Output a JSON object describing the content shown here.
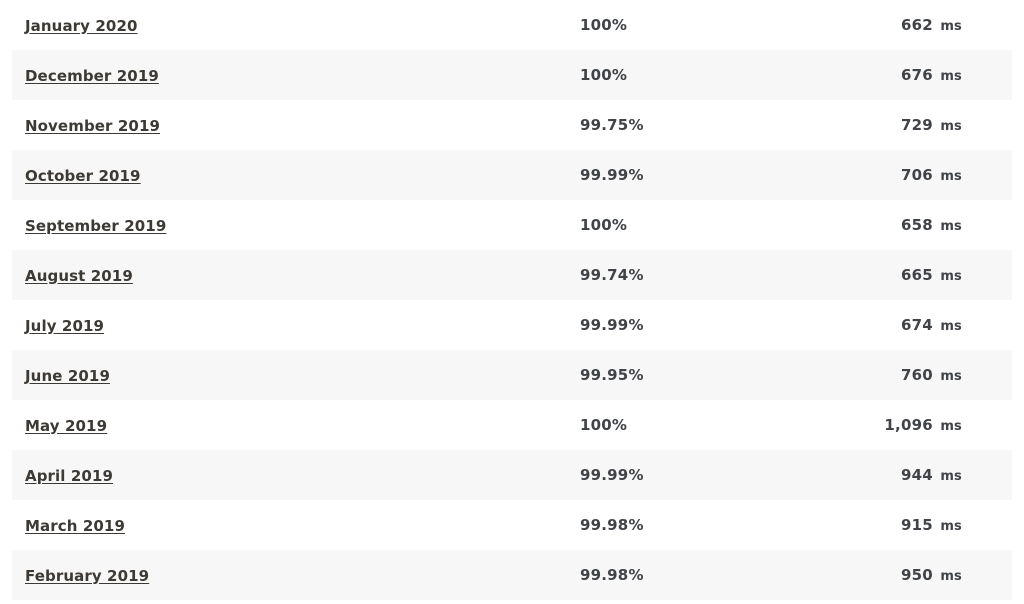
{
  "table": {
    "columns": [
      {
        "key": "month",
        "align": "left"
      },
      {
        "key": "uptime",
        "align": "left"
      },
      {
        "key": "response",
        "align": "right"
      }
    ],
    "unit_label": "ms",
    "rows": [
      {
        "month": "January 2020",
        "uptime": "100%",
        "response": "662",
        "unit": "ms"
      },
      {
        "month": "December 2019",
        "uptime": "100%",
        "response": "676",
        "unit": "ms"
      },
      {
        "month": "November 2019",
        "uptime": "99.75%",
        "response": "729",
        "unit": "ms"
      },
      {
        "month": "October 2019",
        "uptime": "99.99%",
        "response": "706",
        "unit": "ms"
      },
      {
        "month": "September 2019",
        "uptime": "100%",
        "response": "658",
        "unit": "ms"
      },
      {
        "month": "August 2019",
        "uptime": "99.74%",
        "response": "665",
        "unit": "ms"
      },
      {
        "month": "July 2019",
        "uptime": "99.99%",
        "response": "674",
        "unit": "ms"
      },
      {
        "month": "June 2019",
        "uptime": "99.95%",
        "response": "760",
        "unit": "ms"
      },
      {
        "month": "May 2019",
        "uptime": "100%",
        "response": "1,096",
        "unit": "ms"
      },
      {
        "month": "April 2019",
        "uptime": "99.99%",
        "response": "944",
        "unit": "ms"
      },
      {
        "month": "March 2019",
        "uptime": "99.98%",
        "response": "915",
        "unit": "ms"
      },
      {
        "month": "February 2019",
        "uptime": "99.98%",
        "response": "950",
        "unit": "ms"
      }
    ]
  },
  "colors": {
    "page_background": "#ffffff",
    "row_stripe": "#f7f7f7",
    "month_link": "#3d3935",
    "value_text": "#404347"
  }
}
